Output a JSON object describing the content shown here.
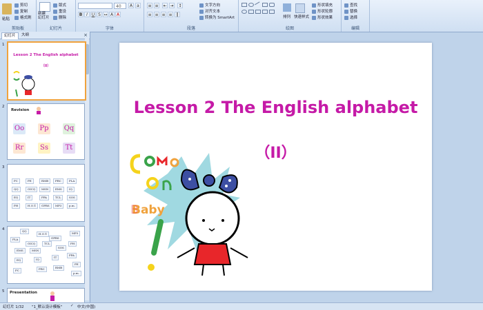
{
  "ribbon": {
    "groups": [
      {
        "label": "剪贴板"
      },
      {
        "label": "幻灯片"
      },
      {
        "label": "字体"
      },
      {
        "label": "段落"
      },
      {
        "label": "绘图"
      },
      {
        "label": "编辑"
      }
    ],
    "clipboard": {
      "paste": "粘贴",
      "cut": "剪切",
      "copy": "复制",
      "format_painter": "格式刷"
    },
    "slides": {
      "new_slide": "新建\n幻灯片",
      "layout": "版式",
      "reset": "重设",
      "delete": "删除"
    },
    "font": {
      "size": "40"
    },
    "paragraph": {
      "text_direction": "文字方向",
      "align_text": "对齐文本",
      "smartart": "转换为 SmartArt"
    },
    "drawing": {
      "arrange": "排列",
      "quick_styles": "快速样式",
      "shape_fill": "形状填充",
      "shape_outline": "形状轮廓",
      "shape_effects": "形状效果"
    },
    "editing": {
      "find": "查找",
      "replace": "替换",
      "select": "选择"
    }
  },
  "panel": {
    "tabs": {
      "slides": "幻灯片",
      "outline": "大纲"
    },
    "thumbnails": [
      {
        "num": "1",
        "title": "Lesson 2  The English alphabet",
        "sub": "（II）"
      },
      {
        "num": "2",
        "title": "Revision",
        "letters": [
          "Oo",
          "Pp",
          "Qq",
          "Rr",
          "Ss",
          "Tt"
        ]
      },
      {
        "num": "3",
        "words": [
          "PC",
          "PE",
          "RMB",
          "PRC",
          "PLA",
          "QQ",
          "OICQ",
          "MSN",
          "EMS",
          "IQ",
          "EQ",
          "IT",
          "PPA",
          "TCL",
          "SOS",
          "PH",
          "H.O.T.",
          "GPRS",
          "MP3",
          "p.m."
        ]
      },
      {
        "num": "4",
        "words": [
          "QQ",
          "H.O.T.",
          "GPRS",
          "MP3",
          "PLA",
          "OICQ",
          "TCL",
          "PH",
          "EMS",
          "MSN",
          "SOS",
          "PPA",
          "EQ",
          "IQ",
          "IT",
          "PE",
          "PC",
          "PRC",
          "RMB",
          "p.m."
        ]
      },
      {
        "num": "5",
        "title": "Presentation"
      }
    ]
  },
  "slide": {
    "title": "Lesson 2   The English alphabet",
    "subtitle": "（II）"
  },
  "status": {
    "slide_count": "幻灯片 1/32",
    "theme": "\"1_默认设计模板\"",
    "language": "中文(中国)"
  },
  "colors": {
    "title": "#c51aa7",
    "accent_yellow": "#f5d31c",
    "accent_green": "#3aa34a",
    "accent_red": "#e8262a"
  }
}
